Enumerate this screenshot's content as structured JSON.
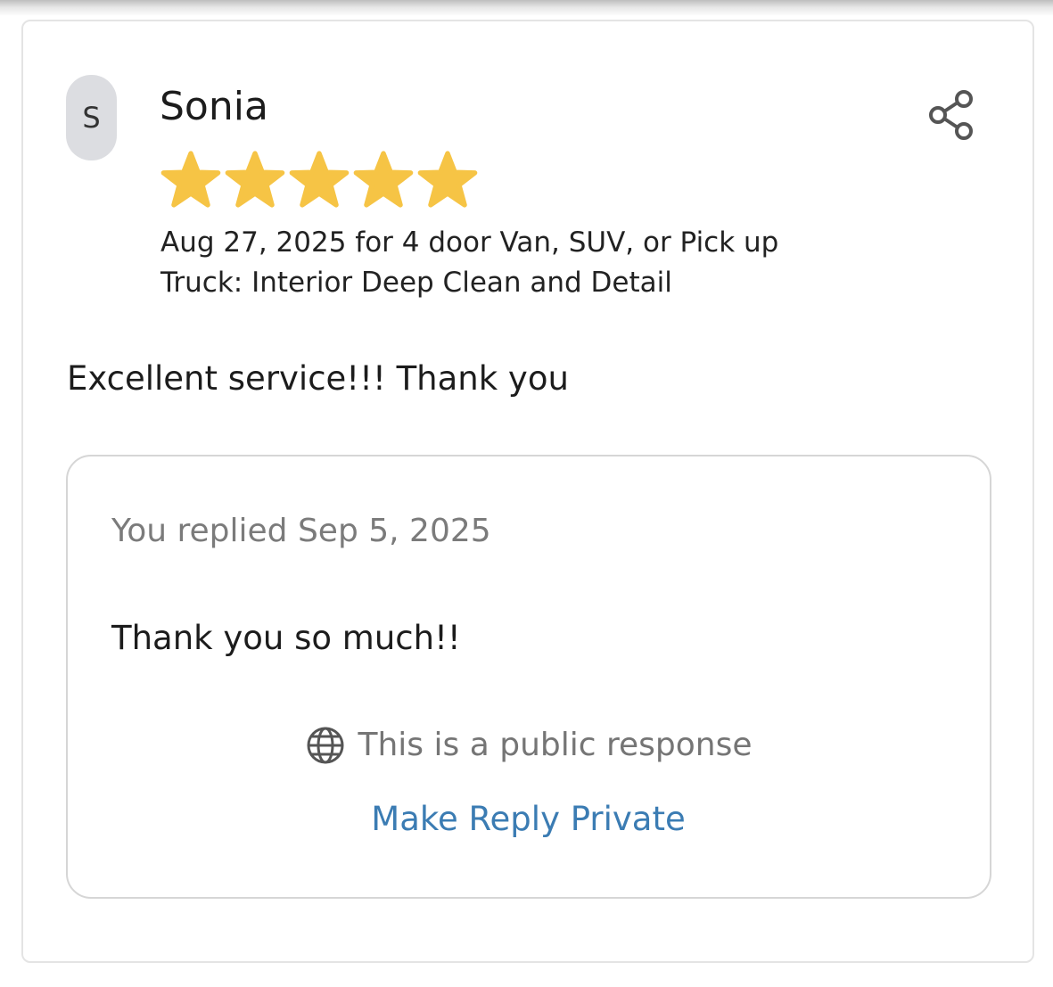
{
  "review": {
    "avatar_initial": "S",
    "reviewer_name": "Sonia",
    "rating": 5,
    "rating_max": 5,
    "star_color": "#F6C445",
    "meta": "Aug 27, 2025 for 4 door Van, SUV, or Pick up Truck: Interior Deep Clean and Detail",
    "body": "Excellent service!!! Thank you",
    "share_icon": "share-icon"
  },
  "reply": {
    "date_text": "You replied Sep 5, 2025",
    "text": "Thank you so much!!",
    "visibility_icon": "globe-icon",
    "visibility_text": "This is a public response",
    "make_private_label": "Make Reply Private",
    "link_color": "#3B7CB3"
  }
}
